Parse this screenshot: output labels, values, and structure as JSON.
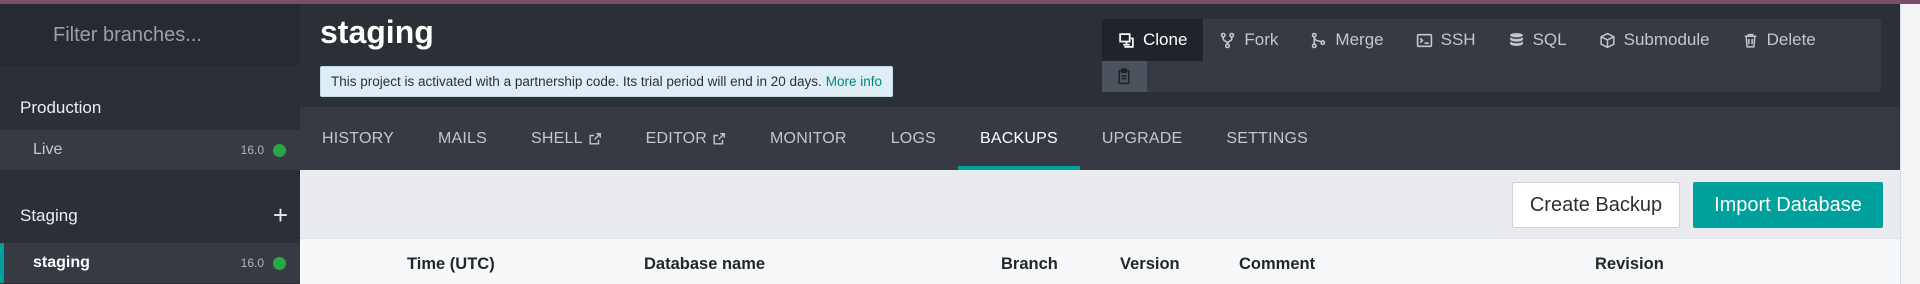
{
  "sidebar": {
    "filter_placeholder": "Filter branches...",
    "sections": [
      {
        "title": "Production",
        "branches": [
          {
            "name": "Live",
            "version": "16.0",
            "status_color": "#28a745"
          }
        ]
      },
      {
        "title": "Staging",
        "add_icon": "plus-icon",
        "branches": [
          {
            "name": "staging",
            "version": "16.0",
            "status_color": "#28a745",
            "active": true
          }
        ]
      }
    ]
  },
  "header": {
    "title": "staging",
    "notice": {
      "text": "This project is activated with a partnership code. Its trial period will end in 20 days.",
      "link": "More info"
    },
    "actions": [
      {
        "label": "Clone",
        "icon": "clone-icon"
      },
      {
        "label": "Fork",
        "icon": "fork-icon"
      },
      {
        "label": "Merge",
        "icon": "merge-icon"
      },
      {
        "label": "SSH",
        "icon": "terminal-icon"
      },
      {
        "label": "SQL",
        "icon": "database-icon"
      },
      {
        "label": "Submodule",
        "icon": "cube-icon"
      },
      {
        "label": "Delete",
        "icon": "trash-icon"
      }
    ],
    "copy_icon": "clipboard-icon"
  },
  "tabs": [
    {
      "label": "HISTORY"
    },
    {
      "label": "MAILS"
    },
    {
      "label": "SHELL",
      "external": true
    },
    {
      "label": "EDITOR",
      "external": true
    },
    {
      "label": "MONITOR"
    },
    {
      "label": "LOGS"
    },
    {
      "label": "BACKUPS",
      "active": true
    },
    {
      "label": "UPGRADE"
    },
    {
      "label": "SETTINGS"
    }
  ],
  "content": {
    "create_backup": "Create Backup",
    "import_database": "Import Database",
    "columns": [
      "Time (UTC)",
      "Database name",
      "Branch",
      "Version",
      "Comment",
      "Revision"
    ]
  },
  "colors": {
    "accent": "#00a09d",
    "sidebar_bg": "#2b2f36",
    "tab_bg": "#363b43",
    "status_green": "#28a745"
  }
}
